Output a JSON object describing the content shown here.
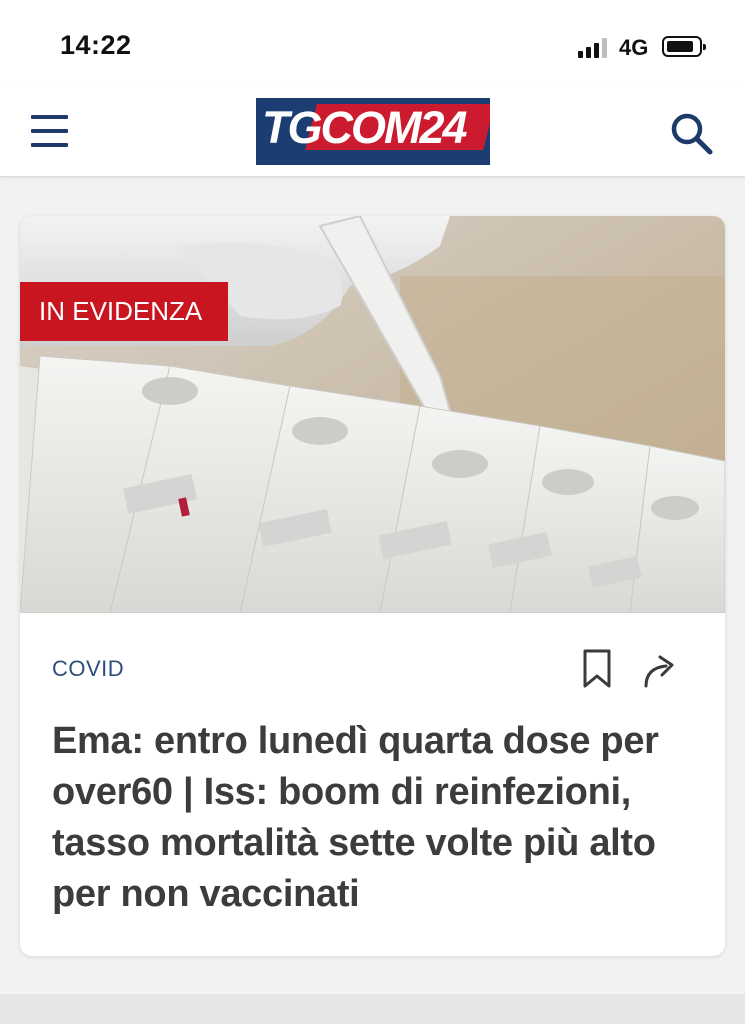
{
  "status_bar": {
    "time": "14:22",
    "network": "4G",
    "signal_icon": "cellular-signal-icon",
    "battery_icon": "battery-icon"
  },
  "header": {
    "menu_icon": "hamburger-menu-icon",
    "logo_text": "TGCOM24",
    "search_icon": "search-icon",
    "brand_colors": {
      "navy": "#1b3d72",
      "red": "#cc1b2e"
    }
  },
  "article": {
    "badge": "IN EVIDENZA",
    "badge_color": "#c8151f",
    "category": "COVID",
    "category_color": "#2c4f7c",
    "bookmark_icon": "bookmark-icon",
    "share_icon": "share-arrow-icon",
    "headline": "Ema: entro lunedì quarta dose per over60 | Iss: boom di reinfezioni, tasso mortalità sette volte più alto per non vaccinati",
    "image_alt": "antigen-test-cassettes-photo"
  }
}
